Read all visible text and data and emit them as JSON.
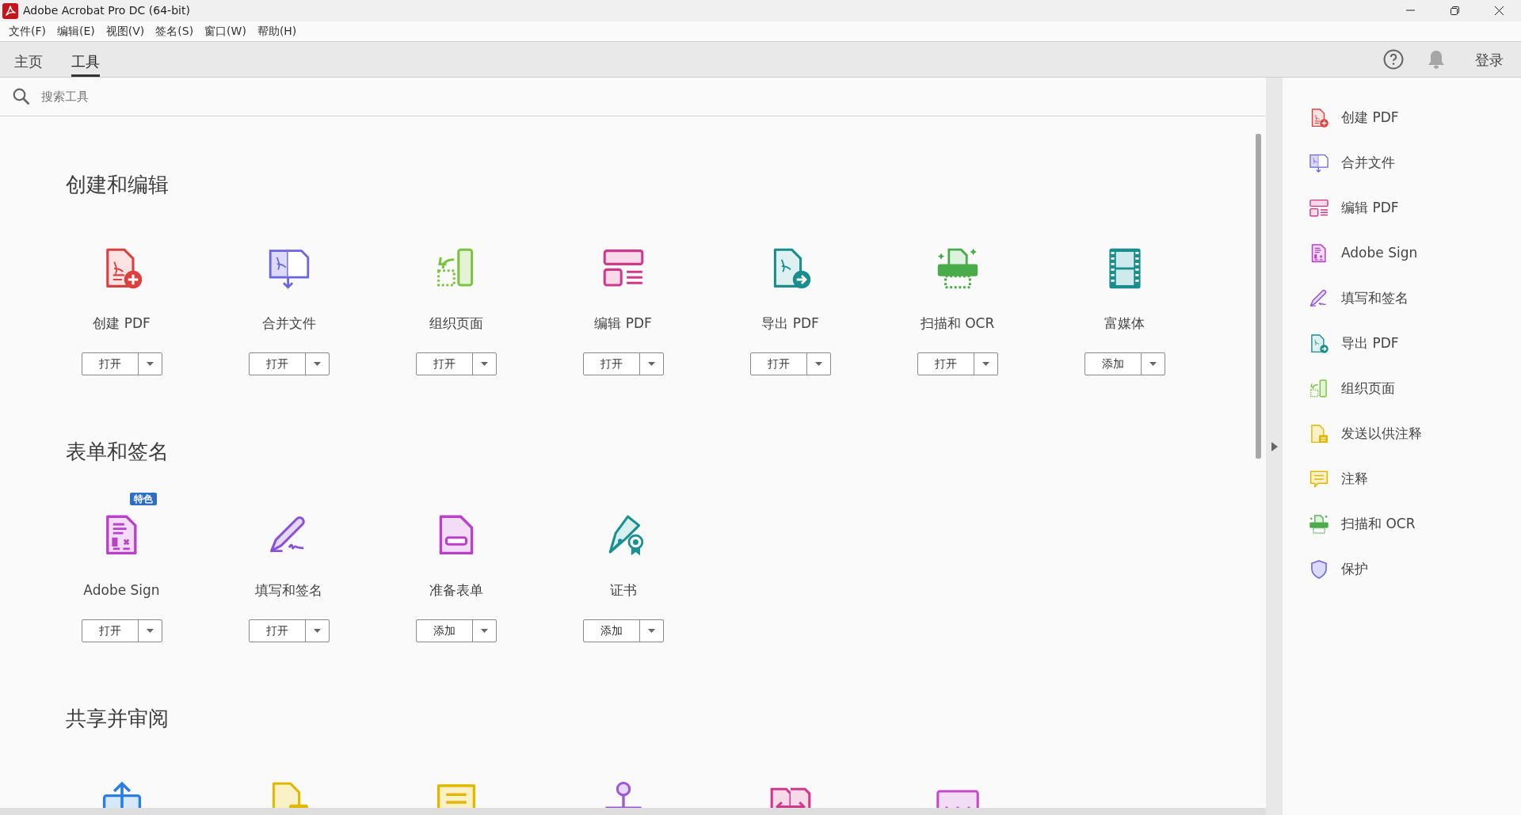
{
  "window": {
    "title": "Adobe Acrobat Pro DC (64-bit)"
  },
  "menu": [
    "文件(F)",
    "编辑(E)",
    "视图(V)",
    "签名(S)",
    "窗口(W)",
    "帮助(H)"
  ],
  "tabs": [
    {
      "label": "主页",
      "selected": false
    },
    {
      "label": "工具",
      "selected": true
    }
  ],
  "header": {
    "sign_in": "登录"
  },
  "search": {
    "placeholder": "搜索工具"
  },
  "sections": [
    {
      "title": "创建和编辑",
      "tools": [
        {
          "kind": "create",
          "label": "创建 PDF",
          "action": "打开"
        },
        {
          "kind": "combine",
          "label": "合并文件",
          "action": "打开"
        },
        {
          "kind": "organize",
          "label": "组织页面",
          "action": "打开"
        },
        {
          "kind": "edit",
          "label": "编辑 PDF",
          "action": "打开"
        },
        {
          "kind": "export",
          "label": "导出 PDF",
          "action": "打开"
        },
        {
          "kind": "scan",
          "label": "扫描和 OCR",
          "action": "打开"
        },
        {
          "kind": "richmedia",
          "label": "富媒体",
          "action": "添加"
        }
      ]
    },
    {
      "title": "表单和签名",
      "tools": [
        {
          "kind": "sign",
          "label": "Adobe Sign",
          "action": "打开",
          "badge": "特色"
        },
        {
          "kind": "fillsign",
          "label": "填写和签名",
          "action": "打开"
        },
        {
          "kind": "prepareform",
          "label": "准备表单",
          "action": "添加"
        },
        {
          "kind": "certificate",
          "label": "证书",
          "action": "添加"
        }
      ]
    },
    {
      "title": "共享并审阅",
      "tools": [
        {
          "kind": "share"
        },
        {
          "kind": "sendcomment"
        },
        {
          "kind": "comment"
        },
        {
          "kind": "stamp"
        },
        {
          "kind": "compare"
        },
        {
          "kind": "measure"
        }
      ]
    }
  ],
  "right_panel": {
    "items": [
      {
        "kind": "create",
        "label": "创建 PDF"
      },
      {
        "kind": "combine",
        "label": "合并文件"
      },
      {
        "kind": "edit",
        "label": "编辑 PDF"
      },
      {
        "kind": "sign",
        "label": "Adobe Sign"
      },
      {
        "kind": "fillsign",
        "label": "填写和签名"
      },
      {
        "kind": "export",
        "label": "导出 PDF"
      },
      {
        "kind": "organize",
        "label": "组织页面"
      },
      {
        "kind": "sendcomment",
        "label": "发送以供注释"
      },
      {
        "kind": "comment",
        "label": "注释"
      },
      {
        "kind": "scan",
        "label": "扫描和 OCR"
      },
      {
        "kind": "protect",
        "label": "保护"
      }
    ]
  }
}
